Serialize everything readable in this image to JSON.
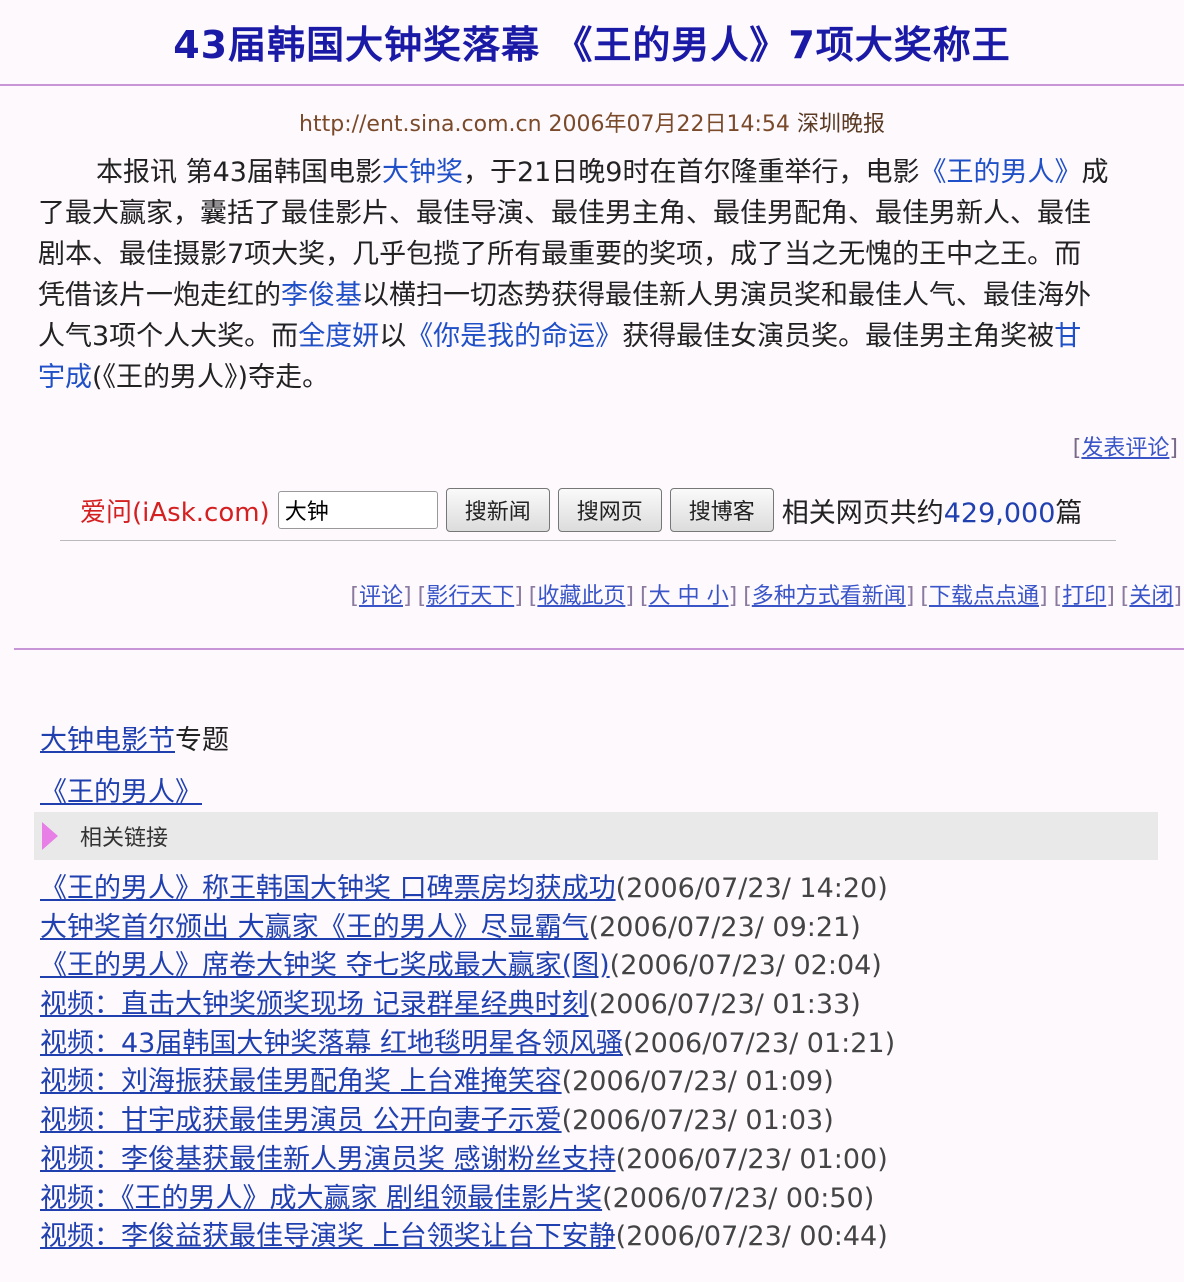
{
  "title": "43届韩国大钟奖落幕 《王的男人》7项大奖称王",
  "source": {
    "url": "http://ent.sina.com.cn",
    "datetime": "2006年07月22日14:54",
    "name": "深圳晚报"
  },
  "article": {
    "l1_a": "本报讯 第43届韩国电影",
    "l1_link1": "大钟奖",
    "l1_b": "，于21日晚9时在首尔隆重举行，电影",
    "l1_link2": "《王的男人》",
    "l1_c": "成",
    "l2": "了最大赢家，囊括了最佳影片、最佳导演、最佳男主角、最佳男配角、最佳男新人、最佳",
    "l3": "剧本、最佳摄影7项大奖，几乎包揽了所有最重要的奖项，成了当之无愧的王中之王。而",
    "l4_a": "凭借该片一炮走红的",
    "l4_link": "李俊基",
    "l4_b": "以横扫一切态势获得最佳新人男演员奖和最佳人气、最佳海外",
    "l5_a": "人气3项个人大奖。而",
    "l5_link1": "全度妍",
    "l5_b": "以",
    "l5_link2": "《你是我的命运》",
    "l5_c": "获得最佳女演员奖。最佳男主角奖被",
    "l5_link3": "甘",
    "l6_link": "宇成",
    "l6_b": "(《王的男人》)夺走。"
  },
  "comment": {
    "open": "[",
    "label": "发表评论",
    "close": "]"
  },
  "iask": {
    "brand": "爱问(iAsk.com)",
    "query": "大钟",
    "btn_news": "搜新闻",
    "btn_web": "搜网页",
    "btn_blog": "搜博客",
    "count_prefix": "相关网页共约",
    "count_value": "429,000",
    "count_suffix": "篇"
  },
  "toolbar": {
    "items": [
      "评论",
      "影行天下",
      "收藏此页",
      "大 中 小",
      "多种方式看新闻",
      "下载点点通",
      "打印",
      "关闭"
    ]
  },
  "topic": {
    "link": "大钟电影节",
    "suffix": "专题"
  },
  "film_link": "《王的男人》",
  "related": {
    "label": "相关链接"
  },
  "news": [
    {
      "title": "《王的男人》称王韩国大钟奖 口碑票房均获成功",
      "date": "(2006/07/23/ 14:20)"
    },
    {
      "title": "大钟奖首尔颁出 大赢家《王的男人》尽显霸气",
      "date": "(2006/07/23/ 09:21)"
    },
    {
      "title": "《王的男人》席卷大钟奖 夺七奖成最大赢家(图)",
      "date": "(2006/07/23/ 02:04)"
    },
    {
      "title": "视频：直击大钟奖颁奖现场 记录群星经典时刻",
      "date": "(2006/07/23/ 01:33)"
    },
    {
      "title": "视频：43届韩国大钟奖落幕 红地毯明星各领风骚",
      "date": "(2006/07/23/ 01:21)"
    },
    {
      "title": "视频：刘海振获最佳男配角奖 上台难掩笑容",
      "date": "(2006/07/23/ 01:09)"
    },
    {
      "title": "视频：甘宇成获最佳男演员 公开向妻子示爱",
      "date": "(2006/07/23/ 01:03)"
    },
    {
      "title": "视频：李俊基获最佳新人男演员奖 感谢粉丝支持",
      "date": "(2006/07/23/ 01:00)"
    },
    {
      "title": "视频：《王的男人》成大赢家 剧组领最佳影片奖",
      "date": "(2006/07/23/ 00:50)"
    },
    {
      "title": "视频：李俊益获最佳导演奖 上台领奖让台下安静",
      "date": "(2006/07/23/ 00:44)"
    }
  ]
}
